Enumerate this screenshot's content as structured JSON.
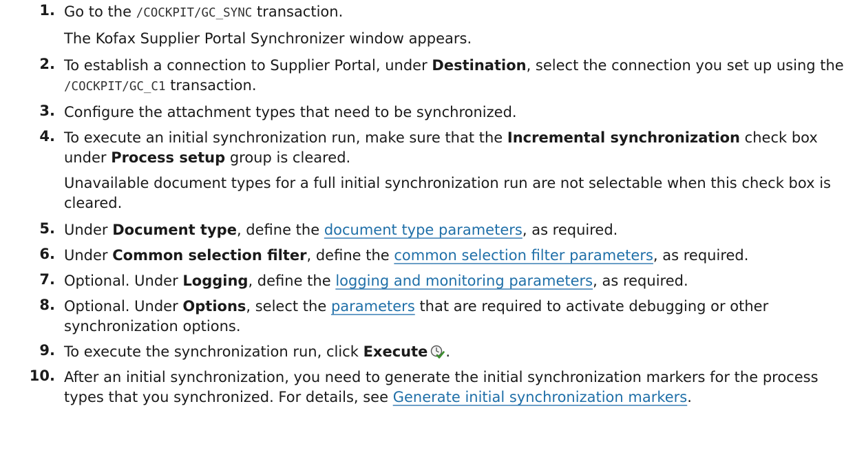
{
  "steps": [
    {
      "number": "1.",
      "main": {
        "t1": "Go to the ",
        "code1": "/COCKPIT/GC_SYNC",
        "t2": " transaction."
      },
      "sub": "The Kofax Supplier Portal Synchronizer window appears."
    },
    {
      "number": "2.",
      "main": {
        "t1": "To establish a connection to Supplier Portal, under ",
        "b1": "Destination",
        "t2": ", select the connection you set up using the ",
        "code1": "/COCKPIT/GC_C1",
        "t3": " transaction."
      }
    },
    {
      "number": "3.",
      "main": {
        "t1": "Configure the attachment types that need to be synchronized."
      }
    },
    {
      "number": "4.",
      "main": {
        "t1": "To execute an initial synchronization run, make sure that the ",
        "b1": "Incremental synchronization",
        "t2": " check box under ",
        "b2": "Process setup",
        "t3": " group is cleared."
      },
      "sub": "Unavailable document types for a full initial synchronization run are not selectable when this check box is cleared."
    },
    {
      "number": "5.",
      "main": {
        "t1": "Under ",
        "b1": "Document type",
        "t2": ", define the ",
        "link1": "document type parameters",
        "t3": ", as required."
      }
    },
    {
      "number": "6.",
      "main": {
        "t1": "Under ",
        "b1": "Common selection filter",
        "t2": ", define the ",
        "link1": "common selection filter parameters",
        "t3": ", as required."
      }
    },
    {
      "number": "7.",
      "main": {
        "t1": "Optional. Under ",
        "b1": "Logging",
        "t2": ", define the ",
        "link1": "logging and monitoring parameters",
        "t3": ", as required."
      }
    },
    {
      "number": "8.",
      "main": {
        "t1": "Optional. Under ",
        "b1": "Options",
        "t2": ", select the ",
        "link1": "parameters",
        "t3": " that are required to activate debugging or other synchronization options."
      }
    },
    {
      "number": "9.",
      "main": {
        "t1": "To execute the synchronization run, click ",
        "b1": "Execute",
        "icon": "execute-icon",
        "t2": "."
      }
    },
    {
      "number": "10.",
      "main": {
        "t1": "After an initial synchronization, you need to generate the initial synchronization markers for the process types that you synchronized. For details, see ",
        "link1": "Generate initial synchronization markers",
        "t2": "."
      }
    }
  ],
  "colors": {
    "text": "#1a1a1a",
    "link": "#1f6fa8",
    "code": "#333333",
    "icon_green": "#3c8f2e"
  }
}
